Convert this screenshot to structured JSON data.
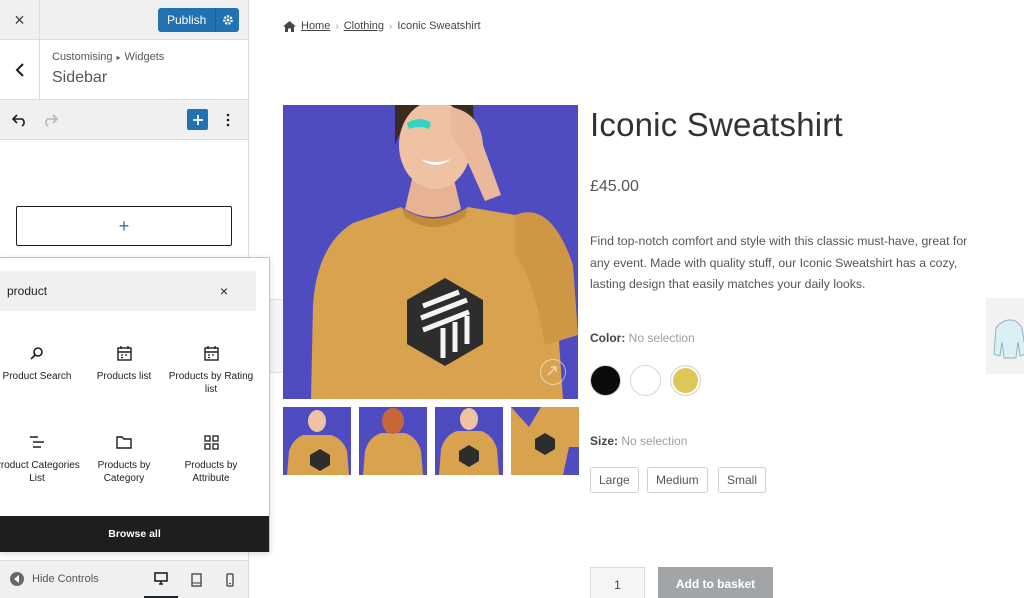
{
  "customizer": {
    "close_label": "×",
    "publish_label": "Publish",
    "breadcrumb_root": "Customising",
    "breadcrumb_child": "Widgets",
    "section_title": "Sidebar",
    "appender_label": "+",
    "inserter": {
      "search_value": "product",
      "clear_label": "×",
      "blocks": [
        {
          "label": "Product Search",
          "icon": "search-icon"
        },
        {
          "label": "Products list",
          "icon": "calendar-icon"
        },
        {
          "label": "Products by Rating list",
          "icon": "calendar-icon"
        },
        {
          "label": "Product Categories List",
          "icon": "list-icon"
        },
        {
          "label": "Products by Category",
          "icon": "folder-icon"
        },
        {
          "label": "Products by Attribute",
          "icon": "grid-icon"
        }
      ],
      "browse_all_label": "Browse all"
    },
    "hide_controls_label": "Hide Controls",
    "accent_color": "#2271b1"
  },
  "preview": {
    "breadcrumb": {
      "home": "Home",
      "category": "Clothing",
      "current": "Iconic Sweatshirt"
    },
    "product": {
      "title": "Iconic Sweatshirt",
      "price": "£45.00",
      "description": "Find top-notch comfort and style with this classic must-have, great for any event. Made with quality stuff, our Iconic Sweatshirt has a cozy, lasting design that easily matches your daily looks.",
      "color_label": "Color:",
      "color_value": "No selection",
      "colors": [
        "#0b0b0b",
        "#ffffff",
        "#ddc857"
      ],
      "size_label": "Size:",
      "size_value": "No selection",
      "sizes": [
        "Large",
        "Medium",
        "Small"
      ],
      "quantity": "1",
      "add_to_basket_label": "Add to basket",
      "image_bg_color": "#4f4cc2",
      "sweater_color": "#d9a24f"
    }
  }
}
